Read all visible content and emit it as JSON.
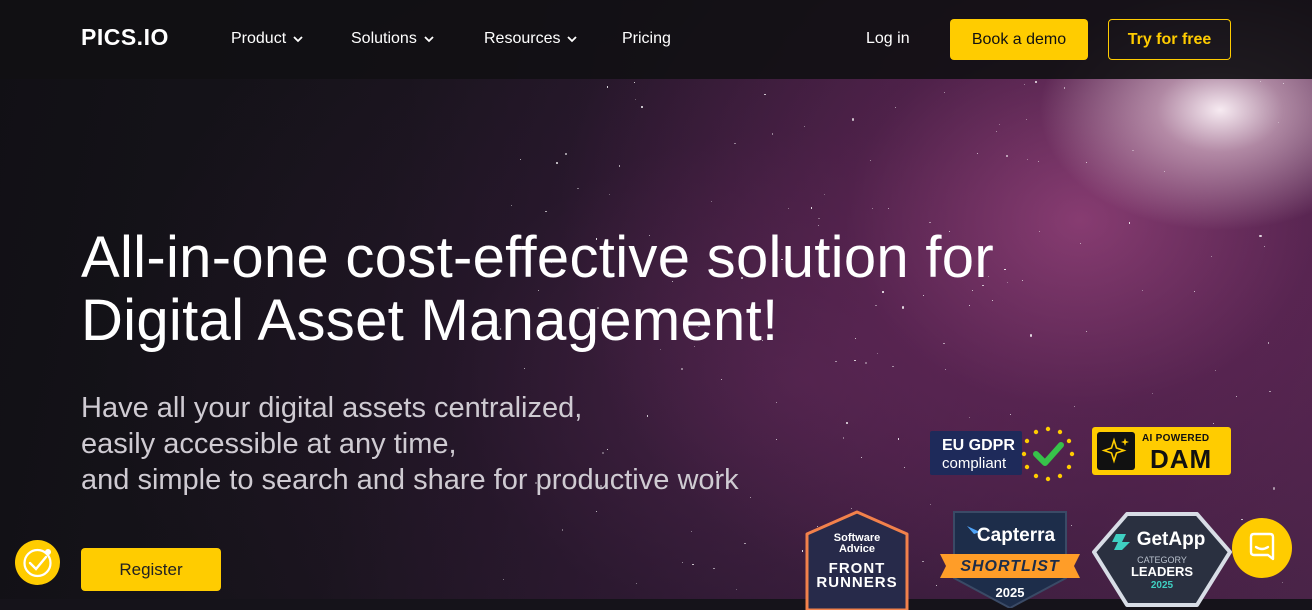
{
  "brand": {
    "logo_text": "PICS.IO"
  },
  "nav": {
    "items": [
      {
        "label": "Product",
        "has_dropdown": true
      },
      {
        "label": "Solutions",
        "has_dropdown": true
      },
      {
        "label": "Resources",
        "has_dropdown": true
      },
      {
        "label": "Pricing",
        "has_dropdown": false
      }
    ],
    "login_label": "Log in",
    "demo_label": "Book a demo",
    "try_label": "Try for free"
  },
  "hero": {
    "headline_line1": "All-in-one cost-effective solution for",
    "headline_line2": "Digital Asset Management!",
    "subline": [
      "Have all your digital assets centralized,",
      "easily accessible at any time,",
      "and simple to search and share for productive work"
    ],
    "register_label": "Register"
  },
  "badges": {
    "gdpr": {
      "line1": "EU GDPR",
      "line2": "compliant"
    },
    "ai_dam": {
      "small": "AI POWERED",
      "big": "DAM"
    },
    "software_advice": {
      "line1": "Software",
      "line2": "Advice",
      "line3": "FRONT",
      "line4": "RUNNERS"
    },
    "capterra": {
      "brand": "Capterra",
      "ribbon": "SHORTLIST",
      "year": "2025"
    },
    "getapp": {
      "brand": "GetApp",
      "sub": "CATEGORY",
      "title": "LEADERS",
      "year": "2025"
    }
  },
  "colors": {
    "accent": "#ffcc00",
    "nav_bg": "#111014"
  },
  "icons": {
    "chat": "chat-bubble-icon",
    "cookie": "cookie-settings-icon"
  }
}
